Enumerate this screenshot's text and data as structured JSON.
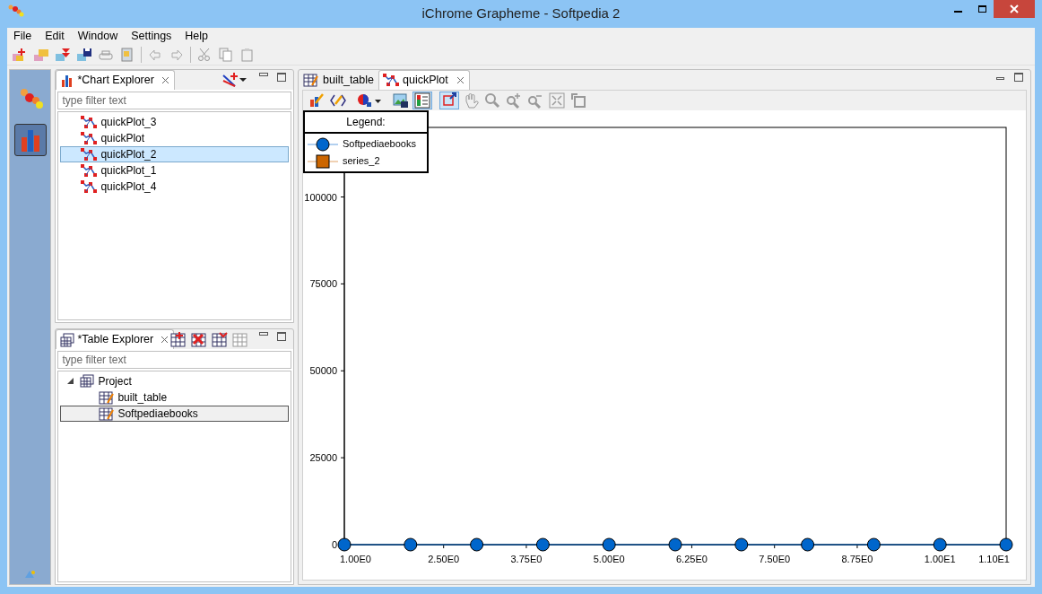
{
  "window": {
    "title": "iChrome Grapheme - Softpedia 2"
  },
  "menu": [
    "File",
    "Edit",
    "Window",
    "Settings",
    "Help"
  ],
  "perspectives": [
    {
      "kind": "dots",
      "selected": false
    },
    {
      "kind": "bars",
      "selected": true
    }
  ],
  "chart_explorer": {
    "title": "*Chart Explorer",
    "filter": {
      "placeholder": "type filter text"
    },
    "items": [
      {
        "label": "quickPlot_3",
        "selected": false
      },
      {
        "label": "quickPlot",
        "selected": false
      },
      {
        "label": "quickPlot_2",
        "selected": true
      },
      {
        "label": "quickPlot_1",
        "selected": false
      },
      {
        "label": "quickPlot_4",
        "selected": false
      }
    ]
  },
  "table_explorer": {
    "title": "*Table Explorer",
    "filter": {
      "placeholder": "type filter text"
    },
    "tree": [
      {
        "label": "Project",
        "expanded": true,
        "selected": false,
        "children": [
          {
            "label": "built_table",
            "selected": false
          },
          {
            "label": "Softpediaebooks",
            "selected": true
          }
        ]
      }
    ]
  },
  "editor": {
    "tabs": [
      {
        "label": "built_table",
        "kind": "table",
        "selected": false
      },
      {
        "label": "quickPlot",
        "kind": "plot",
        "selected": true
      }
    ],
    "tools": [
      {
        "kind": "edit",
        "active": false
      },
      {
        "kind": "script",
        "active": false
      },
      {
        "kind": "color",
        "active": false
      },
      {
        "kind": "export",
        "active": false
      },
      {
        "kind": "legend",
        "active": true
      },
      {
        "kind": "zoom-box",
        "active": true
      },
      {
        "kind": "pan",
        "active": false
      },
      {
        "kind": "zoom",
        "active": false
      },
      {
        "kind": "zoom-in",
        "active": false
      },
      {
        "kind": "zoom-out",
        "active": false
      },
      {
        "kind": "fit",
        "active": false
      },
      {
        "kind": "reset",
        "active": false
      }
    ],
    "legend_title": "Legend:",
    "chart_data": {
      "type": "line",
      "x": [
        1,
        2,
        3,
        4,
        5,
        6,
        7,
        8,
        9,
        10,
        11
      ],
      "series": [
        {
          "name": "Softpediaebooks",
          "color": "#0066cc",
          "marker": "circle",
          "values": [
            0,
            0,
            0,
            0,
            0,
            0,
            0,
            0,
            0,
            0,
            0
          ]
        },
        {
          "name": "series_2",
          "color": "#cc6600",
          "marker": "square",
          "values": [
            null,
            null,
            null,
            null,
            null,
            null,
            null,
            null,
            null,
            null,
            null
          ]
        }
      ],
      "xlim": [
        1,
        11
      ],
      "ylim": [
        0,
        120000
      ],
      "xticks": [
        {
          "value": 1,
          "label": "1.00E0"
        },
        {
          "value": 2.5,
          "label": "2.50E0"
        },
        {
          "value": 3.75,
          "label": "3.75E0"
        },
        {
          "value": 5,
          "label": "5.00E0"
        },
        {
          "value": 6.25,
          "label": "6.25E0"
        },
        {
          "value": 7.5,
          "label": "7.50E0"
        },
        {
          "value": 8.75,
          "label": "8.75E0"
        },
        {
          "value": 10,
          "label": "1.00E1"
        },
        {
          "value": 11,
          "label": "1.10E1"
        }
      ],
      "yticks": [
        0,
        25000,
        50000,
        75000,
        100000
      ]
    }
  }
}
